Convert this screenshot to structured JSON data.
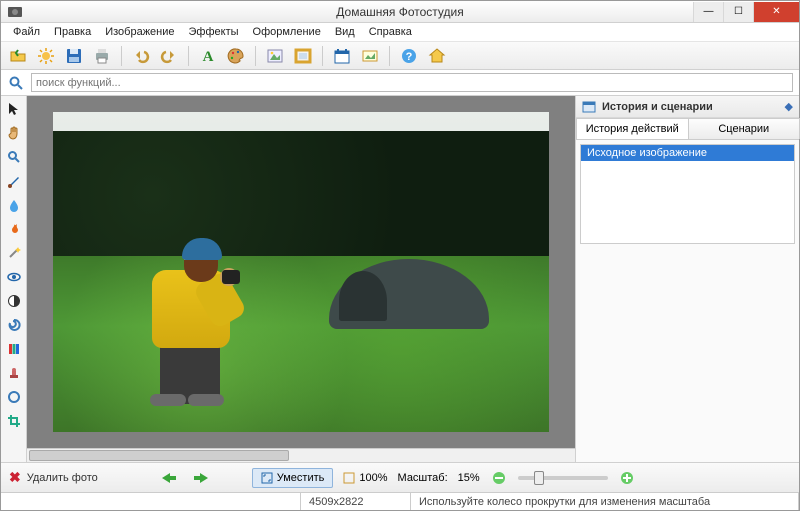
{
  "app": {
    "title": "Домашняя Фотостудия"
  },
  "menu": {
    "items": [
      "Файл",
      "Правка",
      "Изображение",
      "Эффекты",
      "Оформление",
      "Вид",
      "Справка"
    ]
  },
  "search": {
    "placeholder": "поиск функций..."
  },
  "rightPanel": {
    "title": "История и сценарии",
    "tabs": [
      "История действий",
      "Сценарии"
    ],
    "historyItem": "Исходное изображение"
  },
  "bottom": {
    "deleteLabel": "Удалить фото",
    "fitLabel": "Уместить",
    "zoom100": "100%",
    "scaleLabel": "Масштаб:",
    "scaleValue": "15%"
  },
  "status": {
    "dimensions": "4509x2822",
    "hint": "Используйте колесо прокрутки для изменения масштаба"
  },
  "colors": {
    "accent": "#2f7bd6",
    "danger": "#d0402e"
  }
}
